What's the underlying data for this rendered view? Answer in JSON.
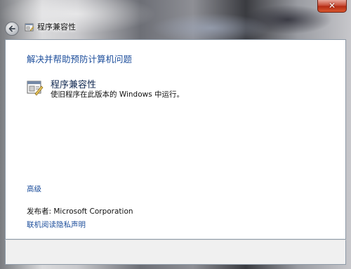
{
  "window": {
    "title": "程序兼容性",
    "close_label": "✕"
  },
  "main": {
    "heading": "解决并帮助预防计算机问题",
    "task": {
      "title": "程序兼容性",
      "description": "使旧程序在此版本的 Windows 中运行。"
    },
    "advanced_link": "高级",
    "publisher": "发布者:  Microsoft Corporation",
    "privacy_link": "联机阅读隐私声明"
  },
  "icons": {
    "back": "back-arrow-icon",
    "title": "compatibility-icon",
    "task": "compatibility-icon"
  },
  "colors": {
    "link": "#1e4f9c",
    "close_button": "#c5452f"
  }
}
